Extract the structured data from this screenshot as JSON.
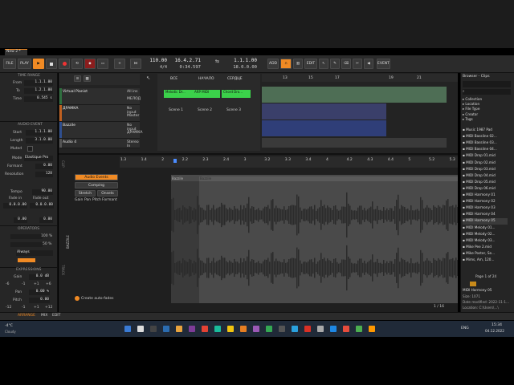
{
  "window": {
    "tab_label": "New 2 *"
  },
  "toolbar": {
    "file": "FILE",
    "play": "PLAY",
    "tempo": "110.00",
    "position": "16.4.2.71",
    "time_signature": "4/4",
    "time": "0:34.597",
    "loop_start": "1.1.1.00",
    "loop_end": "18.0.0.00",
    "add": "ADD",
    "edit": "EDIT",
    "event": "EVENT"
  },
  "inspector": {
    "time_range_title": "TIME RANGE",
    "from_label": "From",
    "from_value": "1.1.1.00",
    "to_label": "To",
    "to_value": "1.2.1.00",
    "time_label": "Time",
    "time_value": "0.545 s",
    "audio_event_title": "AUDIO EVENT",
    "start_label": "Start",
    "start_value": "1.1.1.00",
    "length_label": "Length",
    "length_value": "3.1.0.00",
    "muted_label": "Muted",
    "mode_label": "Mode",
    "mode_value": "Elastique Pro",
    "formant_label": "Formant",
    "formant_value": "0.00",
    "resolution_label": "Resolution",
    "resolution_value": "128",
    "tempo_label": "Tempo",
    "tempo_value": "90.00",
    "fade_in_label": "Fade in",
    "fade_out_label": "Fade out",
    "fade_in_value": "0.0.0.00",
    "fade_out_value": "0.0.0.00",
    "fade_a": "0.00",
    "fade_b": "0.00",
    "operators_title": "OPERATORS",
    "op_pct": "100 %",
    "op_pct2": "50 %",
    "op_mode": "Always",
    "expressions_title": "EXPRESSIONS",
    "gain_label": "Gain",
    "gain_value": "0.0 dB",
    "pan_label": "Pan",
    "pan_value": "0.00 %",
    "pitch_label": "Pitch",
    "pitch_value": "0.00",
    "pitch_ticks": [
      "-12",
      "-1",
      "+1",
      "+12"
    ],
    "gain_ticks": [
      "-6",
      "-1",
      "+1",
      "+6"
    ]
  },
  "tracks": [
    {
      "name": "Virtual Pianist",
      "input": "All ins",
      "route": "МЕЛОД",
      "color": "#2f6f3f"
    },
    {
      "name": "ДРАМКА",
      "input": "No input",
      "route": "Master",
      "color": "#c06020"
    },
    {
      "name": "Bazzile",
      "input": "No input",
      "route": "ДРАМКА",
      "color": "#2f4f8f"
    },
    {
      "name": "Audio 4",
      "input": "Stereo In",
      "route": "Master",
      "color": "#555555"
    }
  ],
  "scenes": {
    "headers": [
      "ВСЕ",
      "НАЧАЛО",
      "СЕРДЦЕ"
    ],
    "clips": [
      "Melodic Dr...",
      "ARP MIDI",
      "Chord Dro..."
    ],
    "scene_labels": [
      "Scene 1",
      "Scene 2",
      "Scene 3"
    ]
  },
  "arranger_ruler": [
    "13",
    "15",
    "17",
    "19",
    "21"
  ],
  "editor": {
    "ruler": [
      "1.3",
      "1.4",
      "2",
      "2.2",
      "2.3",
      "2.4",
      "3",
      "3.2",
      "3.3",
      "3.4",
      "4",
      "4.2",
      "4.3",
      "4.4",
      "5",
      "5.2",
      "5.3"
    ],
    "side_label": "CLIP",
    "track_label": "TRACK",
    "clip_name": "BAZZILE",
    "audio_events_label": "Audio Events",
    "comping_label": "Comping",
    "stretch_label": "Stretch",
    "onsets_label": "Onsets",
    "gain_tab": "Gain",
    "pan_tab": "Pan",
    "pitch_tab": "Pitch",
    "formant_tab": "Formant",
    "region_label_1": "Bazzile",
    "region_label_2": "Bazzile",
    "create_fades": "Create auto-fades",
    "zoom": "1 / 16"
  },
  "browser": {
    "title": "Browser - Clips",
    "categories": [
      "Collection",
      "Location",
      "File Type",
      "Creator",
      "Tags"
    ],
    "files": [
      "Music 1987 Pad",
      "MIDI Bassline 02...",
      "MIDI Bassline 03...",
      "MIDI Bassline 04...",
      "MIDI Drop 01.mid",
      "MIDI Drop 02.mid",
      "MIDI Drop 03.mid",
      "MIDI Drop 04.mid",
      "MIDI Drop 05.mid",
      "MIDI Drop 06.mid",
      "MIDI Harmony 01",
      "MIDI Harmony 02",
      "MIDI Harmony 03",
      "MIDI Harmony 04",
      "MIDI Harmony 05",
      "MIDI Melody 01...",
      "MIDI Melody 02...",
      "MIDI Melody 03...",
      "Mike Pee 2.mid",
      "Mike Poster, Se...",
      "Mims, Am, 120..."
    ],
    "page": "Page 1 of 24",
    "selected_name": "MIDI Harmony 05",
    "size": "Size: 1071",
    "date": "Date modified: 2022-11-1...",
    "location": "Location: C:\\Users\\...\\"
  },
  "bottom_bar": {
    "arrange": "ARRANGE",
    "mix": "MIX",
    "edit": "EDIT"
  },
  "taskbar": {
    "weather_temp": "-4°C",
    "weather_desc": "Cloudy",
    "lang": "ENG",
    "time": "15:34",
    "date": "04.12.2022"
  }
}
